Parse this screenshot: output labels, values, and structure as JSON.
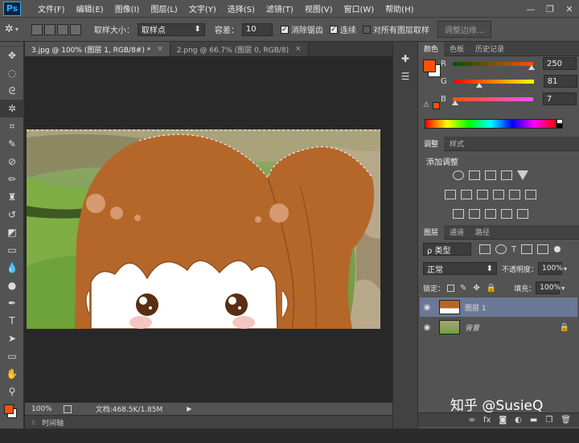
{
  "app": {
    "logo": "Ps"
  },
  "menu": [
    "文件(F)",
    "编辑(E)",
    "图像(I)",
    "图层(L)",
    "文字(Y)",
    "选择(S)",
    "滤镜(T)",
    "视图(V)",
    "窗口(W)",
    "帮助(H)"
  ],
  "window_controls": {
    "minimize": "—",
    "restore": "❐",
    "close": "✕"
  },
  "options": {
    "sample_size_label": "取样大小：",
    "sample_size_value": "取样点",
    "tolerance_label": "容差：",
    "tolerance_value": "10",
    "antialias_label": "消除锯齿",
    "contiguous_label": "连续",
    "all_layers_label": "对所有图层取样",
    "refine_edge_label": "调整边缘..."
  },
  "tabs": [
    {
      "label": "3.jpg @ 100% (图层 1, RGB/8#) *",
      "close": "×",
      "active": true
    },
    {
      "label": "2.png @ 66.7% (图层 0, RGB/8)",
      "close": "×",
      "active": false
    }
  ],
  "status": {
    "zoom": "100%",
    "doc": "文档:468.5K/1.85M"
  },
  "timeline": {
    "label": "时间轴"
  },
  "color_panel": {
    "tabs": [
      "颜色",
      "色板",
      "历史记录"
    ],
    "channels": [
      {
        "label": "R",
        "value": "250",
        "fraction": 0.98
      },
      {
        "label": "G",
        "value": "81",
        "fraction": 0.32
      },
      {
        "label": "B",
        "value": "7",
        "fraction": 0.03
      }
    ],
    "foreground": "#fa5107",
    "background": "#ffffff"
  },
  "adjust_panel": {
    "tabs": [
      "调整",
      "样式"
    ],
    "title": "添加调整"
  },
  "layers_panel": {
    "tabs": [
      "图层",
      "通道",
      "路径"
    ],
    "filter_label": "ρ 类型",
    "blend_mode": "正常",
    "opacity_label": "不透明度：",
    "opacity_value": "100%",
    "lock_label": "锁定：",
    "fill_label": "填充：",
    "fill_value": "100%",
    "layers": [
      {
        "name": "图层 1",
        "selected": true,
        "locked": false
      },
      {
        "name": "背景",
        "selected": false,
        "locked": true
      }
    ]
  },
  "watermark": "知乎 @SusieQ",
  "icons": {
    "move": "move-icon",
    "marquee": "marquee-icon",
    "lasso": "lasso-icon",
    "magic_wand": "magic-wand-icon",
    "crop": "crop-icon",
    "eyedropper": "eyedropper-icon",
    "healing": "healing-icon",
    "brush": "brush-icon",
    "stamp": "stamp-icon",
    "history_brush": "history-brush-icon",
    "eraser": "eraser-icon",
    "gradient": "gradient-icon",
    "blur": "blur-icon",
    "dodge": "dodge-icon",
    "pen": "pen-icon",
    "type": "type-icon",
    "path_select": "path-select-icon",
    "shape": "shape-icon",
    "hand": "hand-icon",
    "zoom": "zoom-icon"
  }
}
